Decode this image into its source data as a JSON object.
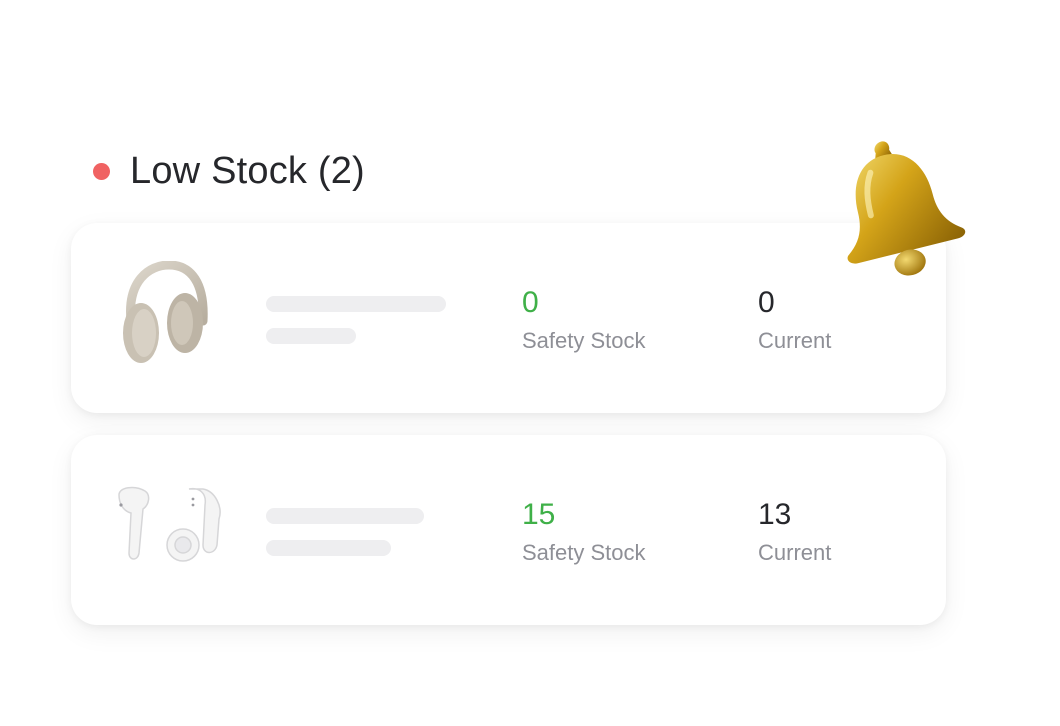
{
  "header": {
    "title": "Low Stock (2)",
    "status_color": "#f06262"
  },
  "items": [
    {
      "product_icon": "headphones-icon",
      "safety_stock": {
        "value": "0",
        "label": "Safety Stock"
      },
      "current": {
        "value": "0",
        "label": "Current"
      }
    },
    {
      "product_icon": "earbuds-icon",
      "safety_stock": {
        "value": "15",
        "label": "Safety Stock"
      },
      "current": {
        "value": "13",
        "label": "Current"
      }
    }
  ],
  "accent": {
    "green": "#3fb048"
  },
  "notification_icon": "bell-icon"
}
